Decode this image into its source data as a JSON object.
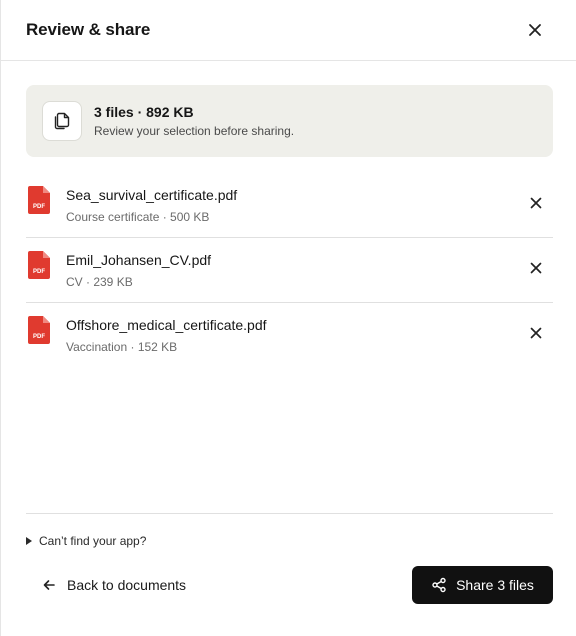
{
  "header": {
    "title": "Review & share"
  },
  "summary": {
    "title": "3 files · 892 KB",
    "subtitle": "Review your selection before sharing."
  },
  "files": [
    {
      "name": "Sea_survival_certificate.pdf",
      "meta": "Course certificate · 500 KB",
      "badge": "PDF"
    },
    {
      "name": "Emil_Johansen_CV.pdf",
      "meta": "CV · 239 KB",
      "badge": "PDF"
    },
    {
      "name": "Offshore_medical_certificate.pdf",
      "meta": "Vaccination · 152 KB",
      "badge": "PDF"
    }
  ],
  "footer": {
    "disclosure_label": "Can’t find your app?",
    "back_label": "Back to documents",
    "share_label": "Share 3 files"
  },
  "colors": {
    "pdf_red": "#e03a2f",
    "summary_bg": "#efefea",
    "primary_button": "#111111"
  }
}
